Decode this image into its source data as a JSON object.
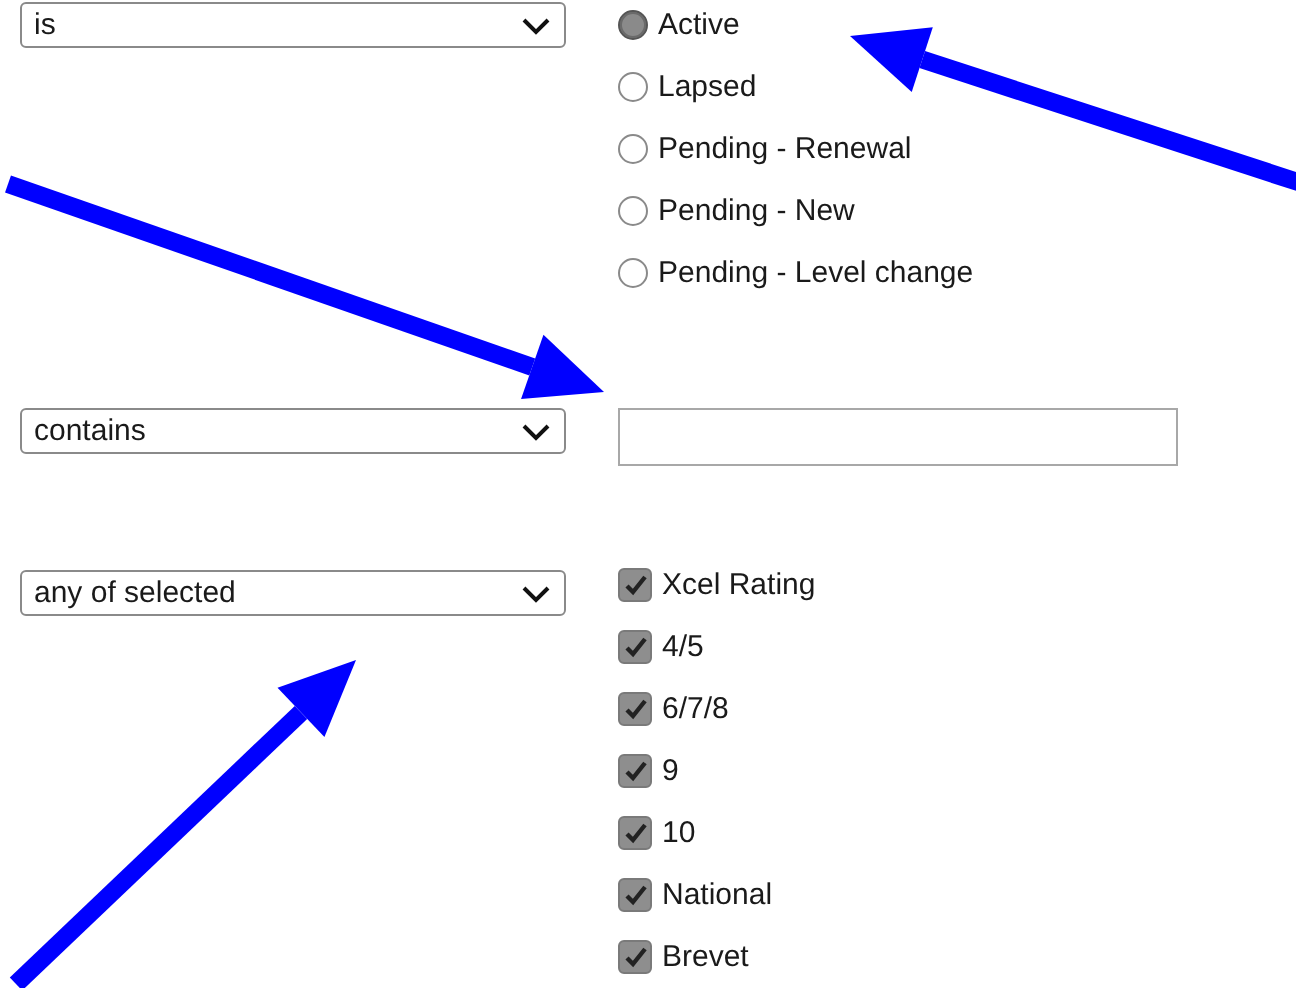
{
  "filters": [
    {
      "kind": "radio",
      "operator": "is",
      "options": [
        {
          "label": "Active",
          "selected": true
        },
        {
          "label": "Lapsed",
          "selected": false
        },
        {
          "label": "Pending - Renewal",
          "selected": false
        },
        {
          "label": "Pending - New",
          "selected": false
        },
        {
          "label": "Pending - Level change",
          "selected": false
        }
      ]
    },
    {
      "kind": "text",
      "operator": "contains"
    },
    {
      "kind": "checkbox",
      "operator": "any of selected",
      "options": [
        {
          "label": "Xcel Rating",
          "checked": true
        },
        {
          "label": "4/5",
          "checked": true
        },
        {
          "label": "6/7/8",
          "checked": true
        },
        {
          "label": "9",
          "checked": true
        },
        {
          "label": "10",
          "checked": true
        },
        {
          "label": "National",
          "checked": true
        },
        {
          "label": "Brevet",
          "checked": true
        }
      ]
    }
  ]
}
